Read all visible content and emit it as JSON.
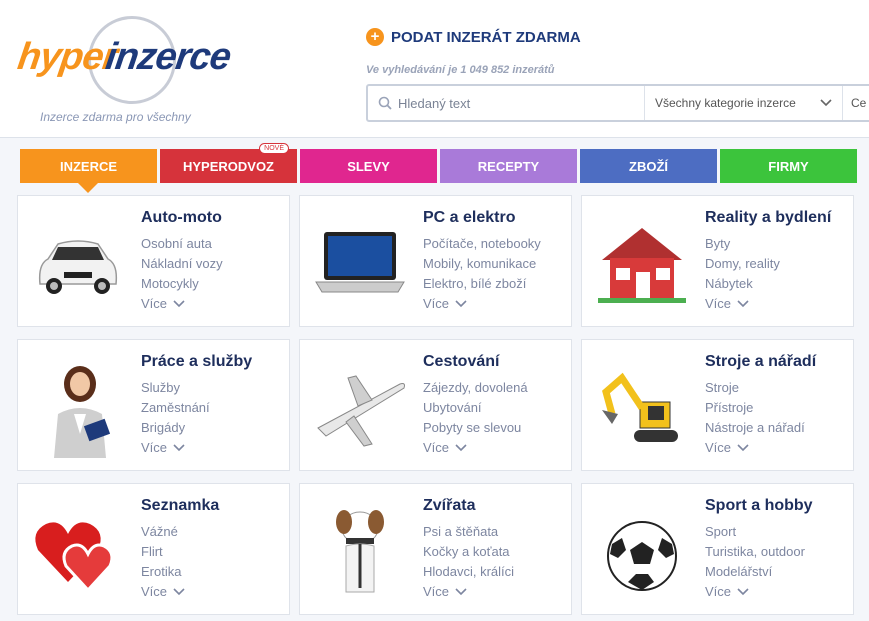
{
  "header": {
    "logo_hyper": "hyper",
    "logo_inzerce": "inzerce",
    "tagline": "Inzerce zdarma pro všechny",
    "post_label": "PODAT INZERÁT ZDARMA",
    "count_text": "Ve vyhledávání je 1 049 852 inzerátů",
    "search_placeholder": "Hledaný text",
    "category_select": "Všechny kategorie inzerce",
    "price_select_partial": "Ce"
  },
  "tabs": [
    {
      "label": "INZERCE",
      "color": "#f7941d"
    },
    {
      "label": "HYPERODVOZ",
      "color": "#d6333b",
      "badge": "NOVÉ"
    },
    {
      "label": "SLEVY",
      "color": "#e0268f"
    },
    {
      "label": "RECEPTY",
      "color": "#a97ad9"
    },
    {
      "label": "ZBOŽÍ",
      "color": "#4d6dc2"
    },
    {
      "label": "FIRMY",
      "color": "#3cc43c"
    }
  ],
  "categories": [
    {
      "title": "Auto-moto",
      "links": [
        "Osobní auta",
        "Nákladní vozy",
        "Motocykly"
      ],
      "more": "Více",
      "icon": "car-icon"
    },
    {
      "title": "PC a elektro",
      "links": [
        "Počítače, notebooky",
        "Mobily, komunikace",
        "Elektro, bílé zboží"
      ],
      "more": "Více",
      "icon": "laptop-icon"
    },
    {
      "title": "Reality a bydlení",
      "links": [
        "Byty",
        "Domy, reality",
        "Nábytek"
      ],
      "more": "Více",
      "icon": "house-icon"
    },
    {
      "title": "Práce a služby",
      "links": [
        "Služby",
        "Zaměstnání",
        "Brigády"
      ],
      "more": "Více",
      "icon": "businesswoman-icon"
    },
    {
      "title": "Cestování",
      "links": [
        "Zájezdy, dovolená",
        "Ubytování",
        "Pobyty se slevou"
      ],
      "more": "Více",
      "icon": "airplane-icon"
    },
    {
      "title": "Stroje a nářadí",
      "links": [
        "Stroje",
        "Přístroje",
        "Nástroje a nářadí"
      ],
      "more": "Více",
      "icon": "excavator-icon"
    },
    {
      "title": "Seznamka",
      "links": [
        "Vážné",
        "Flirt",
        "Erotika"
      ],
      "more": "Více",
      "icon": "hearts-icon"
    },
    {
      "title": "Zvířata",
      "links": [
        "Psi a štěňata",
        "Kočky a koťata",
        "Hlodavci, králíci"
      ],
      "more": "Více",
      "icon": "dog-icon"
    },
    {
      "title": "Sport a hobby",
      "links": [
        "Sport",
        "Turistika, outdoor",
        "Modelářství"
      ],
      "more": "Více",
      "icon": "football-icon"
    }
  ]
}
